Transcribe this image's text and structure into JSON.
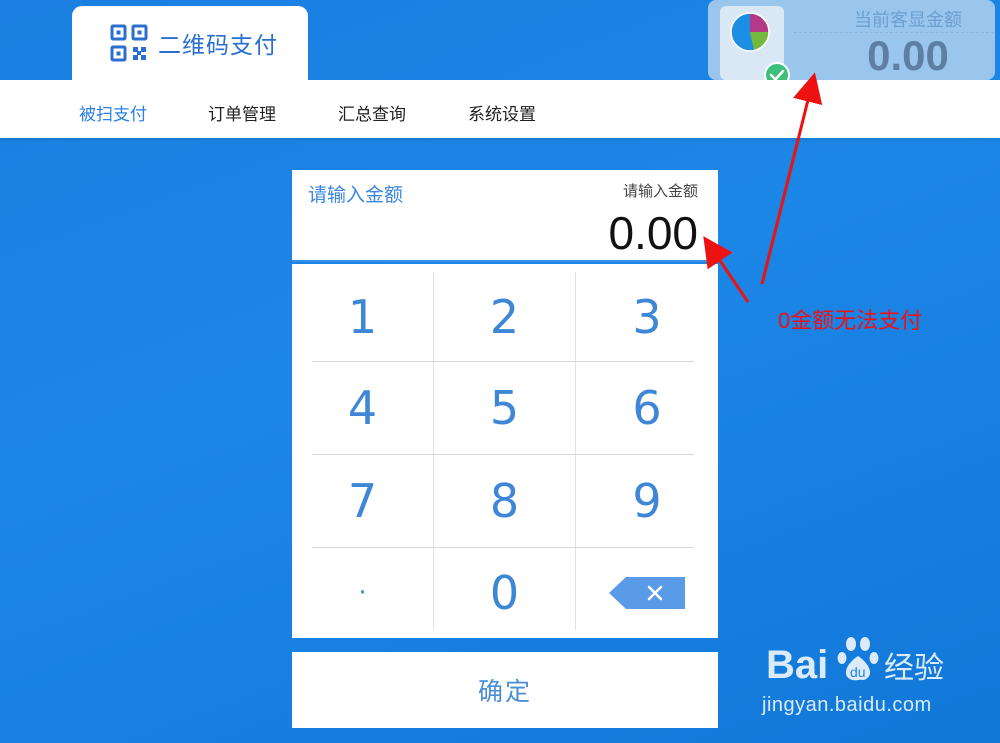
{
  "app_tab": {
    "title": "二维码支付",
    "icon": "qr-code-icon"
  },
  "customer_display": {
    "label": "当前客显金额",
    "amount": "0.00"
  },
  "nav": {
    "items": [
      {
        "label": "被扫支付",
        "active": true
      },
      {
        "label": "订单管理",
        "active": false
      },
      {
        "label": "汇总查询",
        "active": false
      },
      {
        "label": "系统设置",
        "active": false
      }
    ]
  },
  "amount_input": {
    "left_label": "请输入金额",
    "right_label": "请输入金额",
    "value": "0.00"
  },
  "keypad": {
    "keys": [
      "1",
      "2",
      "3",
      "4",
      "5",
      "6",
      "7",
      "8",
      "9",
      "·",
      "0"
    ],
    "backspace_icon": "backspace-icon"
  },
  "confirm": {
    "label": "确定"
  },
  "annotation": {
    "text": "0金额无法支付",
    "color": "#ee1111"
  },
  "watermark": {
    "brand": "Bai经验",
    "url": "jingyan.baidu.com"
  },
  "colors": {
    "accent": "#2a80e6",
    "background": "#1a7fe0"
  }
}
